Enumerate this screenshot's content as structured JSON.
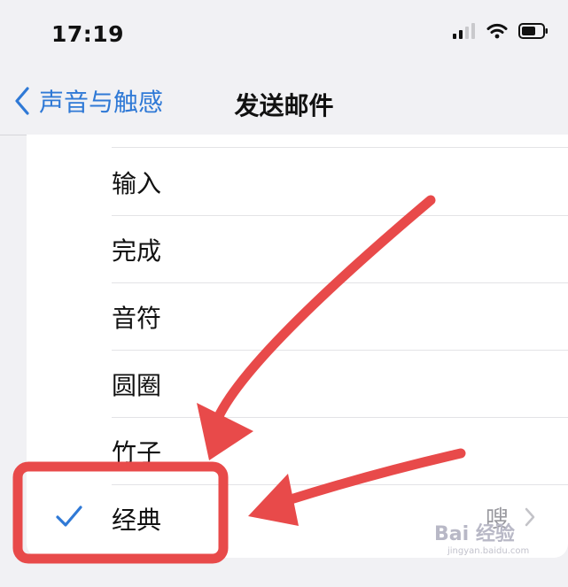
{
  "status": {
    "time": "17:19"
  },
  "nav": {
    "back_label": "声音与触感",
    "title": "发送邮件"
  },
  "tones": [
    {
      "label": "输入",
      "selected": false
    },
    {
      "label": "完成",
      "selected": false
    },
    {
      "label": "音符",
      "selected": false
    },
    {
      "label": "圆圈",
      "selected": false
    },
    {
      "label": "竹子",
      "selected": false
    },
    {
      "label": "经典",
      "selected": true
    }
  ],
  "trailing_value": "嗖",
  "watermark": {
    "text": "Bai 经验",
    "sub": "jingyan.baidu.com"
  },
  "colors": {
    "accent": "#2f79d6",
    "annotation": "#e84a4a"
  }
}
